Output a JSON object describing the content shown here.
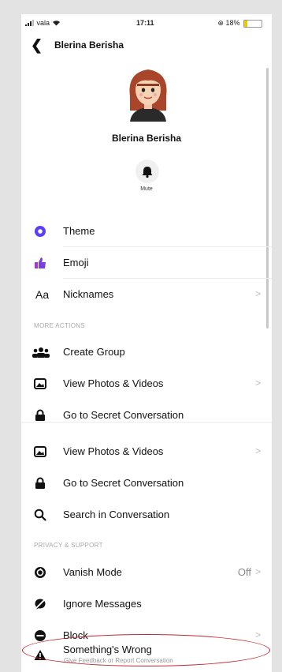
{
  "status_bar": {
    "carrier": "vala",
    "time": "17:11",
    "battery": "18%"
  },
  "nav": {
    "title": "Blerina Berisha"
  },
  "profile": {
    "name": "Blerina Berisha",
    "mute_label": "Mute"
  },
  "menu": {
    "theme": "Theme",
    "emoji": "Emoji",
    "nicknames_icon": "Aa",
    "nicknames": "Nicknames"
  },
  "more_actions": {
    "header": "MORE ACTIONS",
    "create_group": "Create Group",
    "view_photos": "View Photos & Videos",
    "secret_conversation": "Go to Secret Conversation"
  },
  "more_actions_repeat": {
    "view_photos": "View Photos & Videos",
    "secret_conversation": "Go to Secret Conversation",
    "search": "Search in Conversation"
  },
  "privacy": {
    "header": "PRIVACY & SUPPORT",
    "vanish_mode": "Vanish Mode",
    "vanish_value": "Off",
    "ignore_messages": "Ignore Messages",
    "block": "Block",
    "something_wrong": "Something's Wrong",
    "something_wrong_sub": "Give Feedback or Report Conversation"
  },
  "colors": {
    "accent_purple": "#5b3ff6",
    "annotation_red": "#c2252f"
  }
}
